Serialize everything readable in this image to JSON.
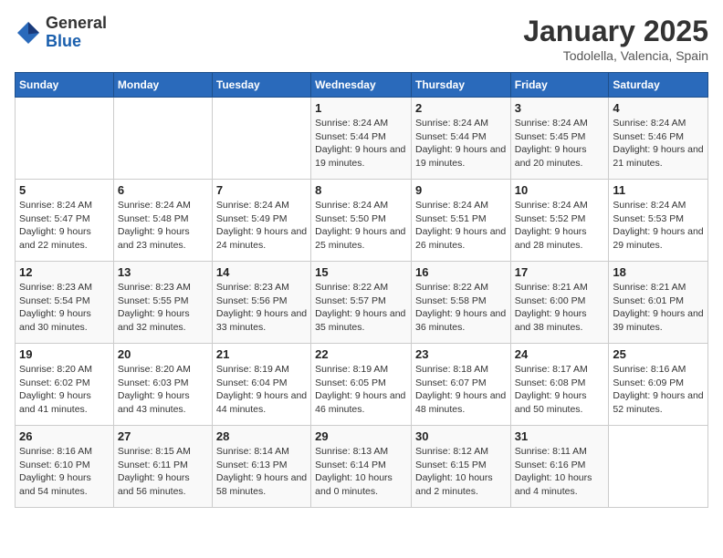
{
  "header": {
    "logo_general": "General",
    "logo_blue": "Blue",
    "title": "January 2025",
    "subtitle": "Todolella, Valencia, Spain"
  },
  "weekdays": [
    "Sunday",
    "Monday",
    "Tuesday",
    "Wednesday",
    "Thursday",
    "Friday",
    "Saturday"
  ],
  "weeks": [
    [
      {
        "day": "",
        "sunrise": "",
        "sunset": "",
        "daylight": ""
      },
      {
        "day": "",
        "sunrise": "",
        "sunset": "",
        "daylight": ""
      },
      {
        "day": "",
        "sunrise": "",
        "sunset": "",
        "daylight": ""
      },
      {
        "day": "1",
        "sunrise": "Sunrise: 8:24 AM",
        "sunset": "Sunset: 5:44 PM",
        "daylight": "Daylight: 9 hours and 19 minutes."
      },
      {
        "day": "2",
        "sunrise": "Sunrise: 8:24 AM",
        "sunset": "Sunset: 5:44 PM",
        "daylight": "Daylight: 9 hours and 19 minutes."
      },
      {
        "day": "3",
        "sunrise": "Sunrise: 8:24 AM",
        "sunset": "Sunset: 5:45 PM",
        "daylight": "Daylight: 9 hours and 20 minutes."
      },
      {
        "day": "4",
        "sunrise": "Sunrise: 8:24 AM",
        "sunset": "Sunset: 5:46 PM",
        "daylight": "Daylight: 9 hours and 21 minutes."
      }
    ],
    [
      {
        "day": "5",
        "sunrise": "Sunrise: 8:24 AM",
        "sunset": "Sunset: 5:47 PM",
        "daylight": "Daylight: 9 hours and 22 minutes."
      },
      {
        "day": "6",
        "sunrise": "Sunrise: 8:24 AM",
        "sunset": "Sunset: 5:48 PM",
        "daylight": "Daylight: 9 hours and 23 minutes."
      },
      {
        "day": "7",
        "sunrise": "Sunrise: 8:24 AM",
        "sunset": "Sunset: 5:49 PM",
        "daylight": "Daylight: 9 hours and 24 minutes."
      },
      {
        "day": "8",
        "sunrise": "Sunrise: 8:24 AM",
        "sunset": "Sunset: 5:50 PM",
        "daylight": "Daylight: 9 hours and 25 minutes."
      },
      {
        "day": "9",
        "sunrise": "Sunrise: 8:24 AM",
        "sunset": "Sunset: 5:51 PM",
        "daylight": "Daylight: 9 hours and 26 minutes."
      },
      {
        "day": "10",
        "sunrise": "Sunrise: 8:24 AM",
        "sunset": "Sunset: 5:52 PM",
        "daylight": "Daylight: 9 hours and 28 minutes."
      },
      {
        "day": "11",
        "sunrise": "Sunrise: 8:24 AM",
        "sunset": "Sunset: 5:53 PM",
        "daylight": "Daylight: 9 hours and 29 minutes."
      }
    ],
    [
      {
        "day": "12",
        "sunrise": "Sunrise: 8:23 AM",
        "sunset": "Sunset: 5:54 PM",
        "daylight": "Daylight: 9 hours and 30 minutes."
      },
      {
        "day": "13",
        "sunrise": "Sunrise: 8:23 AM",
        "sunset": "Sunset: 5:55 PM",
        "daylight": "Daylight: 9 hours and 32 minutes."
      },
      {
        "day": "14",
        "sunrise": "Sunrise: 8:23 AM",
        "sunset": "Sunset: 5:56 PM",
        "daylight": "Daylight: 9 hours and 33 minutes."
      },
      {
        "day": "15",
        "sunrise": "Sunrise: 8:22 AM",
        "sunset": "Sunset: 5:57 PM",
        "daylight": "Daylight: 9 hours and 35 minutes."
      },
      {
        "day": "16",
        "sunrise": "Sunrise: 8:22 AM",
        "sunset": "Sunset: 5:58 PM",
        "daylight": "Daylight: 9 hours and 36 minutes."
      },
      {
        "day": "17",
        "sunrise": "Sunrise: 8:21 AM",
        "sunset": "Sunset: 6:00 PM",
        "daylight": "Daylight: 9 hours and 38 minutes."
      },
      {
        "day": "18",
        "sunrise": "Sunrise: 8:21 AM",
        "sunset": "Sunset: 6:01 PM",
        "daylight": "Daylight: 9 hours and 39 minutes."
      }
    ],
    [
      {
        "day": "19",
        "sunrise": "Sunrise: 8:20 AM",
        "sunset": "Sunset: 6:02 PM",
        "daylight": "Daylight: 9 hours and 41 minutes."
      },
      {
        "day": "20",
        "sunrise": "Sunrise: 8:20 AM",
        "sunset": "Sunset: 6:03 PM",
        "daylight": "Daylight: 9 hours and 43 minutes."
      },
      {
        "day": "21",
        "sunrise": "Sunrise: 8:19 AM",
        "sunset": "Sunset: 6:04 PM",
        "daylight": "Daylight: 9 hours and 44 minutes."
      },
      {
        "day": "22",
        "sunrise": "Sunrise: 8:19 AM",
        "sunset": "Sunset: 6:05 PM",
        "daylight": "Daylight: 9 hours and 46 minutes."
      },
      {
        "day": "23",
        "sunrise": "Sunrise: 8:18 AM",
        "sunset": "Sunset: 6:07 PM",
        "daylight": "Daylight: 9 hours and 48 minutes."
      },
      {
        "day": "24",
        "sunrise": "Sunrise: 8:17 AM",
        "sunset": "Sunset: 6:08 PM",
        "daylight": "Daylight: 9 hours and 50 minutes."
      },
      {
        "day": "25",
        "sunrise": "Sunrise: 8:16 AM",
        "sunset": "Sunset: 6:09 PM",
        "daylight": "Daylight: 9 hours and 52 minutes."
      }
    ],
    [
      {
        "day": "26",
        "sunrise": "Sunrise: 8:16 AM",
        "sunset": "Sunset: 6:10 PM",
        "daylight": "Daylight: 9 hours and 54 minutes."
      },
      {
        "day": "27",
        "sunrise": "Sunrise: 8:15 AM",
        "sunset": "Sunset: 6:11 PM",
        "daylight": "Daylight: 9 hours and 56 minutes."
      },
      {
        "day": "28",
        "sunrise": "Sunrise: 8:14 AM",
        "sunset": "Sunset: 6:13 PM",
        "daylight": "Daylight: 9 hours and 58 minutes."
      },
      {
        "day": "29",
        "sunrise": "Sunrise: 8:13 AM",
        "sunset": "Sunset: 6:14 PM",
        "daylight": "Daylight: 10 hours and 0 minutes."
      },
      {
        "day": "30",
        "sunrise": "Sunrise: 8:12 AM",
        "sunset": "Sunset: 6:15 PM",
        "daylight": "Daylight: 10 hours and 2 minutes."
      },
      {
        "day": "31",
        "sunrise": "Sunrise: 8:11 AM",
        "sunset": "Sunset: 6:16 PM",
        "daylight": "Daylight: 10 hours and 4 minutes."
      },
      {
        "day": "",
        "sunrise": "",
        "sunset": "",
        "daylight": ""
      }
    ]
  ]
}
